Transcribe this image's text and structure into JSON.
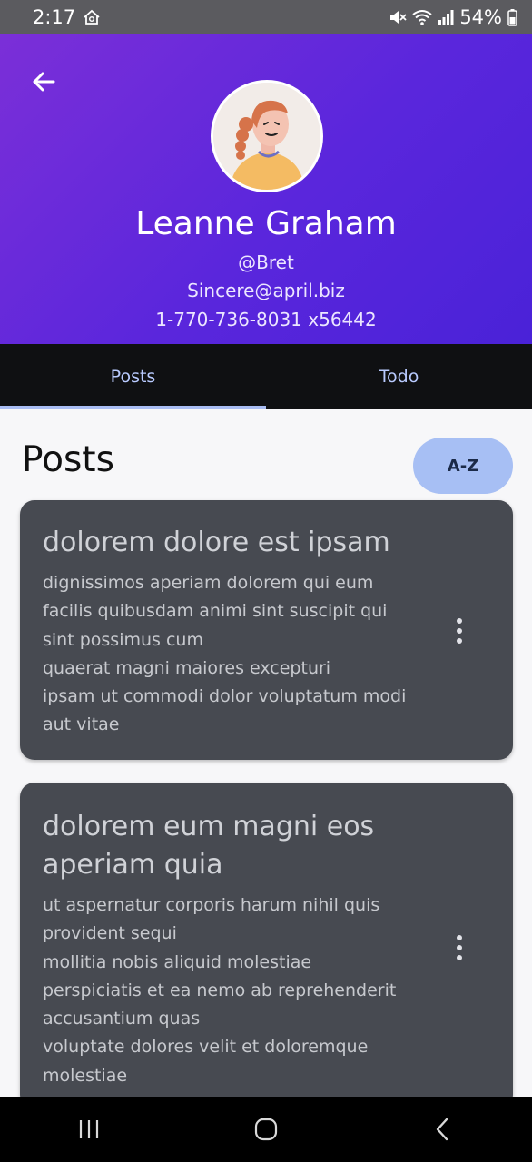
{
  "status_bar": {
    "time": "2:17",
    "battery": "54%",
    "icons": [
      "home-icon",
      "mute-icon",
      "wifi-icon",
      "signal-icon",
      "battery-icon"
    ]
  },
  "header": {
    "back_icon": "arrow-left-icon",
    "name": "Leanne Graham",
    "username": "@Bret",
    "email": "Sincere@april.biz",
    "phone": "1-770-736-8031 x56442",
    "gradient_start": "#7b2fd8",
    "gradient_end": "#4a22d8"
  },
  "tabs": [
    {
      "label": "Posts",
      "active": true
    },
    {
      "label": "Todo",
      "active": false
    }
  ],
  "section": {
    "title": "Posts",
    "sort_label": "A-Z"
  },
  "posts": [
    {
      "title": "dolorem dolore est ipsam",
      "body": "dignissimos aperiam dolorem qui eum\nfacilis quibusdam animi sint suscipit qui\nsint possimus cum\nquaerat magni maiores excepturi\nipsam ut commodi dolor voluptatum modi\naut vitae"
    },
    {
      "title": "dolorem eum magni eos aperiam quia",
      "body": "ut aspernatur corporis harum nihil quis\nprovident sequi\nmollitia nobis aliquid molestiae\nperspiciatis et ea nemo ab reprehenderit\naccusantium quas\nvoluptate dolores velit et doloremque\nmolestiae"
    }
  ],
  "colors": {
    "accent": "#a7bff4",
    "card": "#474a51",
    "tab_bar": "#0f1012"
  },
  "nav_bar": [
    "recents-icon",
    "home-icon",
    "back-icon"
  ]
}
